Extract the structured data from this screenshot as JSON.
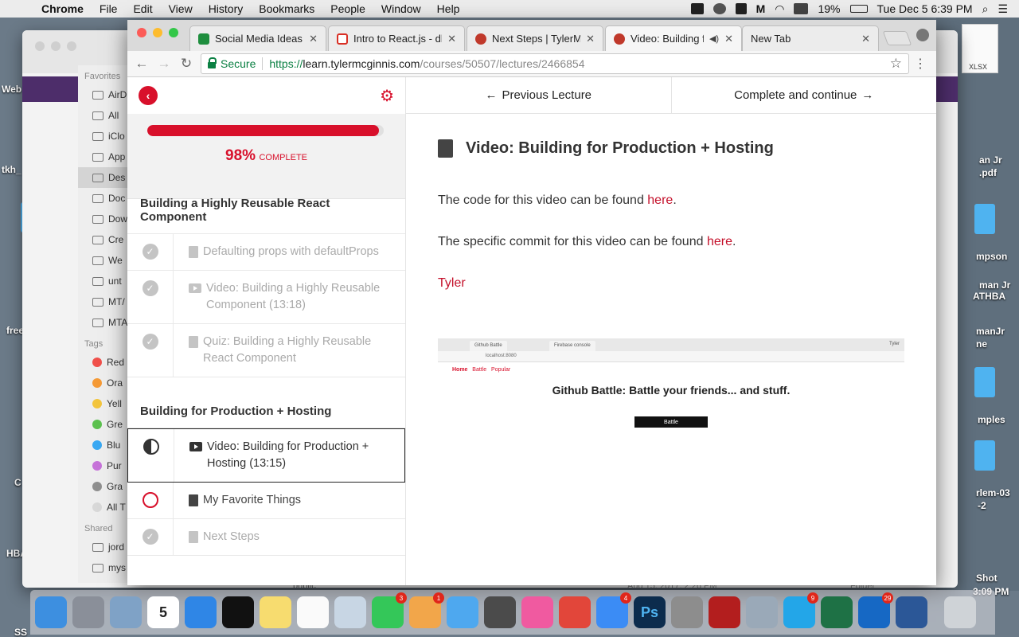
{
  "menubar": {
    "app_name": "Chrome",
    "items": [
      "File",
      "Edit",
      "View",
      "History",
      "Bookmarks",
      "People",
      "Window",
      "Help"
    ],
    "battery": "19%",
    "clock": "Tue Dec 5  6:39 PM"
  },
  "desktop": {
    "labels": [
      "Web",
      "tkh_",
      "free",
      "C",
      "HBA",
      "SS"
    ],
    "right_labels": [
      "man Jr",
      "ATHBA",
      "an Jr",
      ".pdf",
      "mpson",
      "manJr",
      "ne",
      "mples",
      "rlem-03",
      "-2",
      "Shot",
      "3:09 PM",
      "XLSX"
    ]
  },
  "finder": {
    "favorites_heading": "Favorites",
    "favorites": [
      "AirD",
      "All",
      "iClo",
      "App",
      "Des",
      "Doc",
      "Dow",
      "Cre",
      "We",
      "unt",
      "MT/",
      "MTA"
    ],
    "tags_heading": "Tags",
    "tags": [
      {
        "label": "Red",
        "color": "#f0504b"
      },
      {
        "label": "Ora",
        "color": "#f59a36"
      },
      {
        "label": "Yell",
        "color": "#f3c53d"
      },
      {
        "label": "Gre",
        "color": "#5cc14f"
      },
      {
        "label": "Blu",
        "color": "#39a8f2"
      },
      {
        "label": "Pur",
        "color": "#c673d9"
      },
      {
        "label": "Gra",
        "color": "#8f8f8f"
      },
      {
        "label": "All T",
        "color": "#d8d8d8"
      }
    ],
    "shared_heading": "Shared",
    "shared": [
      "jord",
      "mys"
    ],
    "footer_file": "public",
    "footer_date": "Aug 15, 2017, 2:26 PM",
    "footer_kind": "Folder"
  },
  "browser": {
    "tabs": [
      {
        "title": "Social Media Ideas - ",
        "favicon_color": "#1e8e3e"
      },
      {
        "title": "Intro to React.js - dh",
        "favicon_color": "#d93025"
      },
      {
        "title": "Next Steps | TylerMc",
        "favicon_color": "#c0392b"
      },
      {
        "title": "Video: Building fo",
        "favicon_color": "#c0392b",
        "active": true
      },
      {
        "title": "New Tab",
        "favicon_color": ""
      }
    ],
    "secure_label": "Secure",
    "url_scheme": "https://",
    "url_host": "learn.tylermcginnis.com",
    "url_path": "/courses/50507/lectures/2466854"
  },
  "sidebar": {
    "progress_percent": 98,
    "progress_text": "98%",
    "progress_label": "COMPLETE",
    "sections": [
      {
        "title": "Building a Highly Reusable React Component",
        "lessons": [
          {
            "title": "Defaulting props with defaultProps",
            "type": "doc",
            "status": "complete"
          },
          {
            "title": "Video: Building a Highly Reusable Component (13:18)",
            "type": "video",
            "status": "complete"
          },
          {
            "title": "Quiz: Building a Highly Reusable React Component",
            "type": "doc",
            "status": "complete"
          }
        ]
      },
      {
        "title": "Building for Production + Hosting",
        "lessons": [
          {
            "title": "Video: Building for Production + Hosting (13:15)",
            "type": "video",
            "status": "current"
          },
          {
            "title": "My Favorite Things",
            "type": "doc",
            "status": "incomplete"
          },
          {
            "title": "Next Steps",
            "type": "doc",
            "status": "complete"
          }
        ]
      }
    ]
  },
  "content": {
    "prev_label": "Previous Lecture",
    "next_label": "Complete and continue",
    "title": "Video: Building for Production + Hosting",
    "para1_text": "The code for this video can be found ",
    "para1_link": "here",
    "para2_text": "The specific commit for this video can be found ",
    "para2_link": "here",
    "signature": "Tyler",
    "shot": {
      "tab1": "Github Battle",
      "tab2": "Firebase console",
      "user": "Tyler",
      "url": "localhost:8080",
      "nav": [
        "Home",
        "Battle",
        "Popular"
      ],
      "headline": "Github Battle: Battle your friends... and stuff.",
      "button": "Battle"
    }
  },
  "dock": {
    "apps": [
      {
        "name": "finder",
        "color": "#3d8fe0"
      },
      {
        "name": "launchpad",
        "color": "#8a8f99"
      },
      {
        "name": "mail-stamp",
        "color": "#7fa2c6"
      },
      {
        "name": "calendar",
        "color": "#ffffff",
        "label": "5"
      },
      {
        "name": "safari",
        "color": "#2f86e6"
      },
      {
        "name": "tidal",
        "color": "#111111"
      },
      {
        "name": "notes",
        "color": "#f7dc6f"
      },
      {
        "name": "reminders",
        "color": "#fafafa"
      },
      {
        "name": "preview",
        "color": "#c8d6e4"
      },
      {
        "name": "facetime",
        "color": "#34c759",
        "badge": "3"
      },
      {
        "name": "photos",
        "color": "#f2a64a",
        "badge": "1"
      },
      {
        "name": "messages",
        "color": "#4ea8ef"
      },
      {
        "name": "sublime-text",
        "color": "#4b4b4b"
      },
      {
        "name": "itunes",
        "color": "#f05aa0"
      },
      {
        "name": "chrome",
        "color": "#e2463a"
      },
      {
        "name": "app-store",
        "color": "#3b8cf5",
        "badge": "4"
      },
      {
        "name": "photoshop",
        "color": "#0c2c4d",
        "label": "Ps"
      },
      {
        "name": "system-preferences",
        "color": "#8d8d8d"
      },
      {
        "name": "acrobat",
        "color": "#b31e1e"
      },
      {
        "name": "image-capture",
        "color": "#9aa9b8"
      },
      {
        "name": "skype",
        "color": "#23a6e8",
        "badge": "9"
      },
      {
        "name": "excel",
        "color": "#1e7145"
      },
      {
        "name": "outlook",
        "color": "#1668c4",
        "badge": "29"
      },
      {
        "name": "word",
        "color": "#2b5797"
      },
      {
        "name": "trash",
        "color": "#cfd3d7"
      }
    ]
  }
}
